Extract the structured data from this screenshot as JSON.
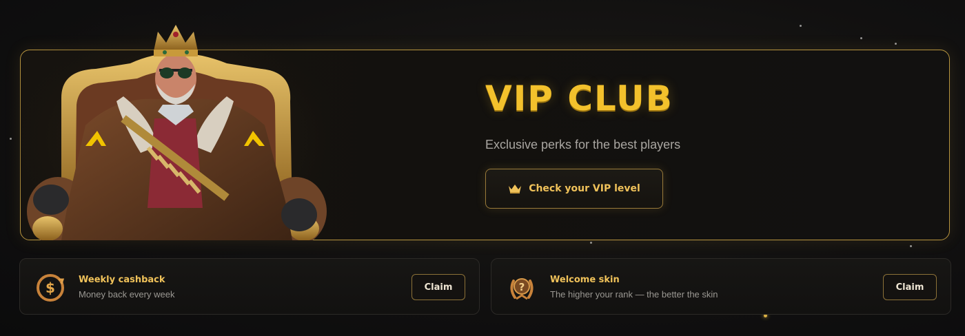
{
  "banner": {
    "title": "VIP CLUB",
    "subtitle": "Exclusive perks for the best players",
    "cta_label": "Check your VIP level",
    "cta_icon": "crown-icon",
    "hero_image": "king-on-throne-illustration"
  },
  "perks": [
    {
      "title": "Weekly cashback",
      "description": "Money back every week",
      "button_label": "Claim",
      "icon": "cashback-dollar-icon"
    },
    {
      "title": "Welcome skin",
      "description": "The higher your rank — the better the skin",
      "button_label": "Claim",
      "icon": "mystery-laurel-icon"
    }
  ],
  "colors": {
    "accent_gold": "#f3c12c",
    "border_gold": "#b8953f",
    "background": "#111010",
    "text_muted": "#a9a6a1"
  }
}
